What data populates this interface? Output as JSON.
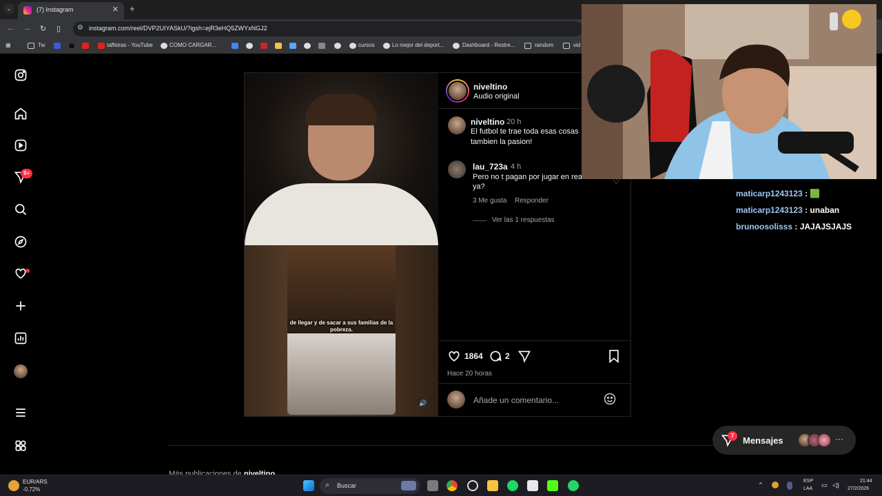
{
  "browser": {
    "tab_title": "(7) Instagram",
    "url": "instagram.com/reel/DVP2UIYASkU/?igsh=ejR3eHQ5ZWYxNGJ2",
    "bookmarks": [
      "Tw",
      "taffeiras - YouTube",
      "COMO CARGAR...",
      "cursos",
      "Lo mejor del deport...",
      "Dashboard - Restre...",
      "random",
      "vid"
    ]
  },
  "sidebar": {
    "notifications_badge": "9+"
  },
  "post": {
    "author": "niveltino",
    "audio": "Audio original",
    "video_subtitle": "de llegar y de sacar a sus familias de la pobreza.",
    "caption": {
      "author": "niveltino",
      "time": "20 h",
      "text_line1": "El futbol te trae toda esas cosas",
      "text_line2": "tambien la pasion!"
    },
    "comment": {
      "author": "lau_723a",
      "time": "4 h",
      "text_line1": "Pero no t pagan por jugar en rea",
      "text_line2": "ya?",
      "likes": "3 Me gusta",
      "reply": "Responder",
      "view_replies": "Ver las 1 respuestas"
    },
    "like_count": "1864",
    "comment_count": "2",
    "posted": "Hace 20 horas",
    "add_comment_placeholder": "Añade un comentario..."
  },
  "more_posts": {
    "prefix": "Más publicaciones de",
    "author": "niveltino"
  },
  "messages": {
    "label": "Mensajes",
    "badge": "7"
  },
  "chat_overlay": [
    {
      "user": "maticarp1243123",
      "sep": " : ",
      "msg": "🟩"
    },
    {
      "user": "maticarp1243123",
      "sep": " : ",
      "msg": "unaban"
    },
    {
      "user": "brunoosolisss",
      "sep": " : ",
      "msg": "JAJAJSJAJS"
    }
  ],
  "taskbar": {
    "currency": "EUR/ARS",
    "currency_change": "-0,72%",
    "search": "Buscar",
    "lang": "ESP",
    "lang2": "LAA",
    "time": "21:44",
    "date": "27/2/2026"
  }
}
